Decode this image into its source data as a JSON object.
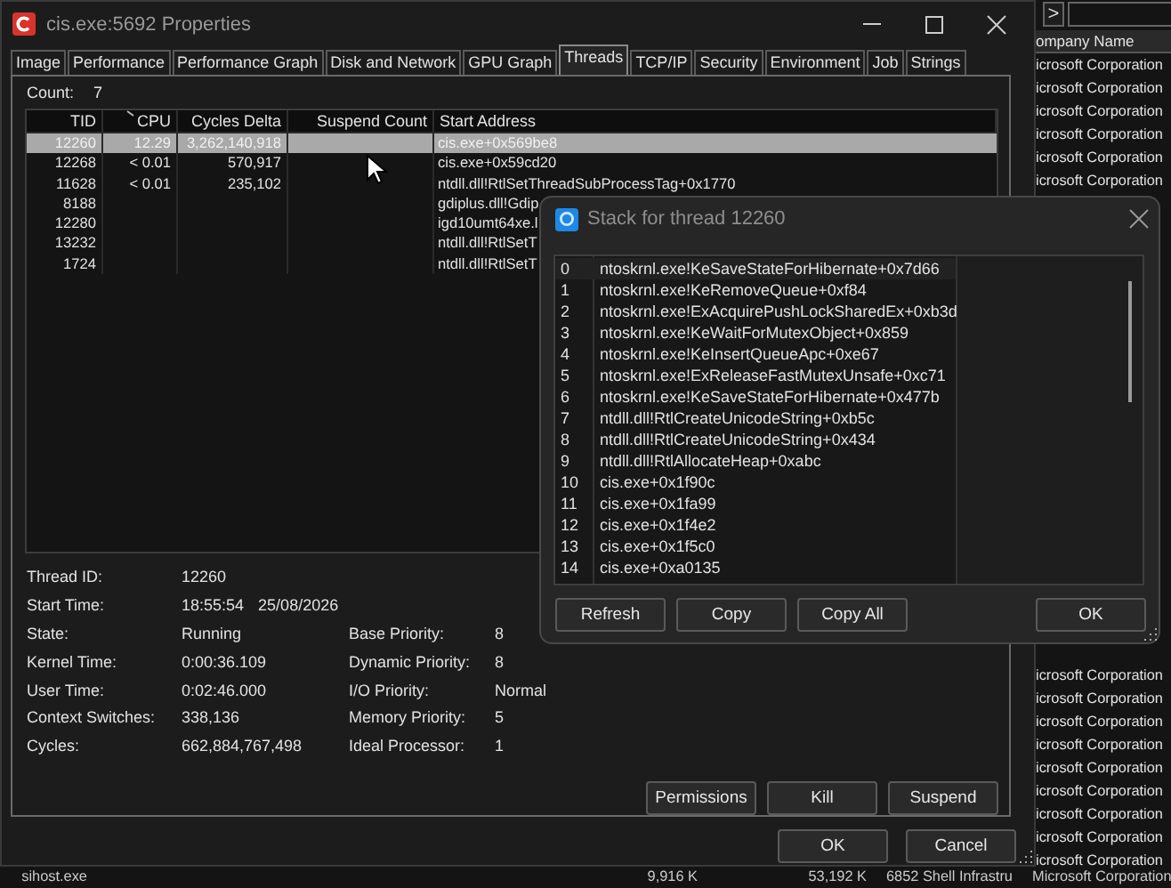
{
  "background": {
    "toolbar_button": ">",
    "company_header": "ompany Name",
    "company_rows_top": [
      "icrosoft Corporation",
      "icrosoft Corporation",
      "icrosoft Corporation",
      "icrosoft Corporation",
      "icrosoft Corporation",
      "icrosoft Corporation"
    ],
    "company_rows_bottom": [
      "icrosoft Corporation",
      "icrosoft Corporation",
      "icrosoft Corporation",
      "icrosoft Corporation",
      "icrosoft Corporation",
      "icrosoft Corporation",
      "icrosoft Corporation",
      "icrosoft Corporation",
      "icrosoft Corporation"
    ],
    "bottom_row": [
      "sihost.exe",
      "9,916 K",
      "53,192 K",
      "6852 Shell Infrastru",
      "Microsoft Corporation"
    ]
  },
  "window": {
    "title": "cis.exe:5692 Properties",
    "tabs": [
      {
        "label": "Image",
        "selected": false
      },
      {
        "label": "Performance",
        "selected": false
      },
      {
        "label": "Performance Graph",
        "selected": false
      },
      {
        "label": "Disk and Network",
        "selected": false
      },
      {
        "label": "GPU Graph",
        "selected": false
      },
      {
        "label": "Threads",
        "selected": true
      },
      {
        "label": "TCP/IP",
        "selected": false
      },
      {
        "label": "Security",
        "selected": false
      },
      {
        "label": "Environment",
        "selected": false
      },
      {
        "label": "Job",
        "selected": false
      },
      {
        "label": "Strings",
        "selected": false
      }
    ],
    "count_label": "Count:",
    "count": "7",
    "table": {
      "columns": [
        "TID",
        "CPU",
        "Cycles Delta",
        "Suspend Count",
        "Start Address"
      ],
      "rows": [
        {
          "tid": "12260",
          "cpu": "12.29",
          "cycles_delta": "3,262,140,918",
          "start_address": "cis.exe+0x569be8",
          "selected": true
        },
        {
          "tid": "12268",
          "cpu": "< 0.01",
          "cycles_delta": "570,917",
          "start_address": "cis.exe+0x59cd20",
          "selected": false
        },
        {
          "tid": "11628",
          "cpu": "< 0.01",
          "cycles_delta": "235,102",
          "start_address": "ntdll.dll!RtlSetThreadSubProcessTag+0x1770",
          "selected": false
        },
        {
          "tid": "8188",
          "start_address": "gdiplus.dll!Gdip",
          "selected": false
        },
        {
          "tid": "12280",
          "start_address": "igd10umt64xe.l",
          "selected": false
        },
        {
          "tid": "13232",
          "start_address": "ntdll.dll!RtlSetT",
          "selected": false
        },
        {
          "tid": "1724",
          "start_address": "ntdll.dll!RtlSetT",
          "selected": false
        }
      ]
    },
    "details": [
      {
        "label": "Thread ID:",
        "values": [
          "12260"
        ]
      },
      {
        "label": "Start Time:",
        "values": [
          "18:55:54",
          "25/08/2026"
        ]
      },
      {
        "label": "State:",
        "values": [
          "Running"
        ],
        "label2": "Base Priority:",
        "value2": "8"
      },
      {
        "label": "Kernel Time:",
        "values": [
          "0:00:36.109"
        ],
        "label2": "Dynamic Priority:",
        "value2": "8"
      },
      {
        "label": "User Time:",
        "values": [
          "0:02:46.000"
        ],
        "label2": "I/O Priority:",
        "value2": "Normal"
      },
      {
        "label": "Context Switches:",
        "values": [
          "338,136"
        ],
        "label2": "Memory Priority:",
        "value2": "5"
      },
      {
        "label": "Cycles:",
        "values": [
          "662,884,767,498"
        ],
        "label2": "Ideal Processor:",
        "value2": "1"
      }
    ],
    "panel_buttons": [
      "Permissions",
      "Kill",
      "Suspend"
    ],
    "buttons": [
      "OK",
      "Cancel"
    ]
  },
  "stack_dialog": {
    "title": "Stack for thread 12260",
    "frames": [
      {
        "number": "0",
        "frame": "ntoskrnl.exe!KeSaveStateForHibernate+0x7d66",
        "selected": true
      },
      {
        "number": "1",
        "frame": "ntoskrnl.exe!KeRemoveQueue+0xf84",
        "selected": false
      },
      {
        "number": "2",
        "frame": "ntoskrnl.exe!ExAcquirePushLockSharedEx+0xb3d",
        "selected": false
      },
      {
        "number": "3",
        "frame": "ntoskrnl.exe!KeWaitForMutexObject+0x859",
        "selected": false
      },
      {
        "number": "4",
        "frame": "ntoskrnl.exe!KeInsertQueueApc+0xe67",
        "selected": false
      },
      {
        "number": "5",
        "frame": "ntoskrnl.exe!ExReleaseFastMutexUnsafe+0xc71",
        "selected": false
      },
      {
        "number": "6",
        "frame": "ntoskrnl.exe!KeSaveStateForHibernate+0x477b",
        "selected": false
      },
      {
        "number": "7",
        "frame": "ntdll.dll!RtlCreateUnicodeString+0xb5c",
        "selected": false
      },
      {
        "number": "8",
        "frame": "ntdll.dll!RtlCreateUnicodeString+0x434",
        "selected": false
      },
      {
        "number": "9",
        "frame": "ntdll.dll!RtlAllocateHeap+0xabc",
        "selected": false
      },
      {
        "number": "10",
        "frame": "cis.exe+0x1f90c",
        "selected": false
      },
      {
        "number": "11",
        "frame": "cis.exe+0x1fa99",
        "selected": false
      },
      {
        "number": "12",
        "frame": "cis.exe+0x1f4e2",
        "selected": false
      },
      {
        "number": "13",
        "frame": "cis.exe+0x1f5c0",
        "selected": false
      },
      {
        "number": "14",
        "frame": "cis.exe+0xa0135",
        "selected": false
      }
    ],
    "buttons": [
      "Refresh",
      "Copy",
      "Copy All"
    ],
    "ok_button": "OK"
  }
}
